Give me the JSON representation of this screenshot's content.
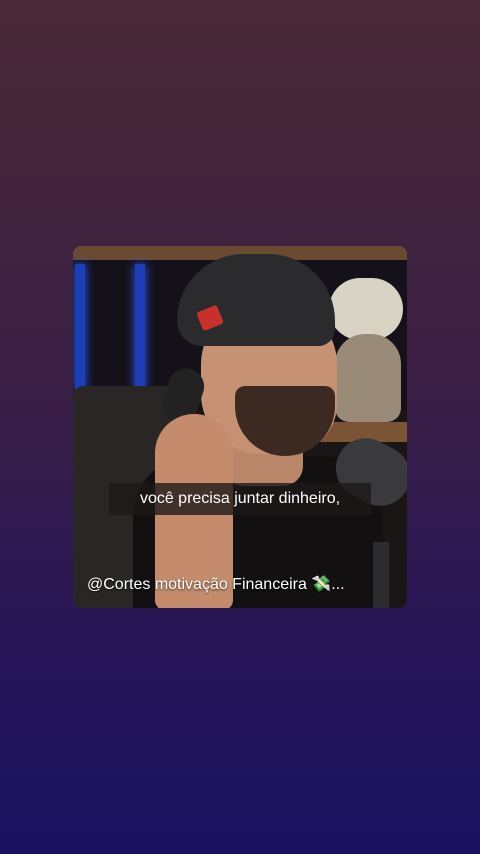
{
  "video": {
    "subtitle": "você precisa juntar dinheiro,",
    "channel_handle": "@Cortes motivação Financeira",
    "handle_icon": "money-with-wings-icon",
    "handle_icon_glyph": "💸",
    "handle_ellipsis": "..."
  },
  "colors": {
    "background_top": "#4a2a35",
    "background_bottom": "#1a1260",
    "caption_bg": "#1e1818"
  }
}
